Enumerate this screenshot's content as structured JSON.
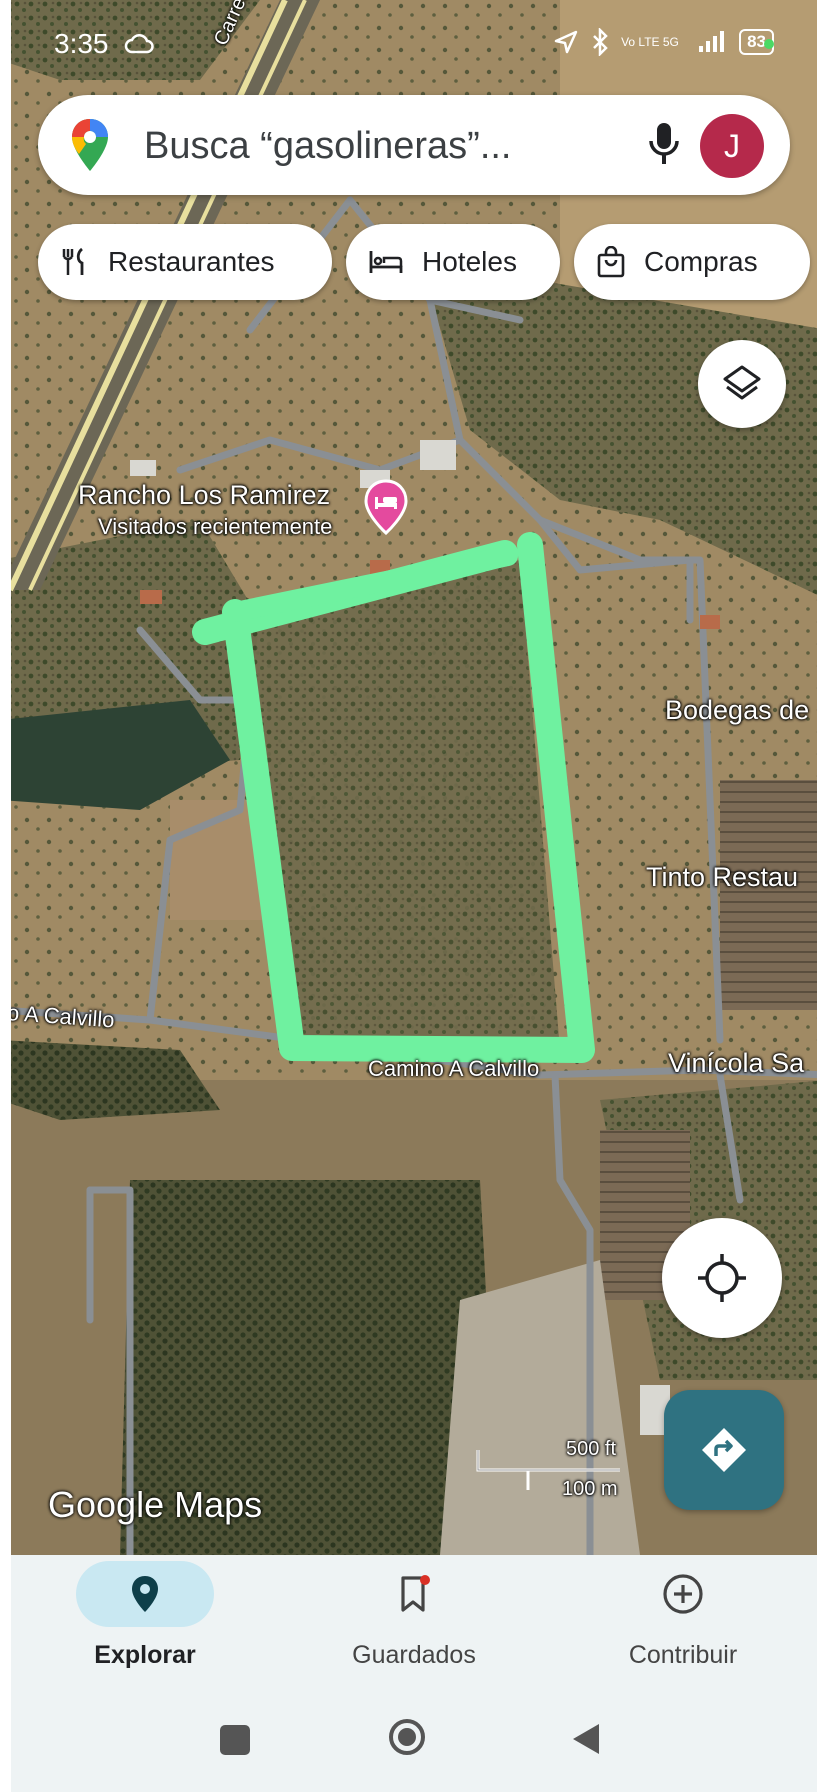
{
  "status_bar": {
    "time": "3:35",
    "network": "Vo LTE 5G",
    "battery": "83"
  },
  "search": {
    "placeholder": "Busca “gasolineras”...",
    "avatar_letter": "J"
  },
  "chips": [
    {
      "label": "Restaurantes",
      "icon": "fork-knife-icon"
    },
    {
      "label": "Hoteles",
      "icon": "bed-icon"
    },
    {
      "label": "Compras",
      "icon": "shopping-bag-icon"
    }
  ],
  "map": {
    "place": {
      "name": "Rancho Los Ramirez",
      "subtitle": "Visitados recientemente",
      "icon": "hotel-pin-icon",
      "pin_color": "#e44a9e"
    },
    "labels": {
      "bodegas": "Bodegas de",
      "tinto": "Tinto Restau",
      "camino_left": "o A Calvillo",
      "camino_center": "Camino A Calvillo",
      "vinicola": "Vinícola Sa",
      "carretera": "Carretera"
    },
    "scale": {
      "imperial": "500 ft",
      "metric": "100 m"
    },
    "watermark": "Google Maps",
    "highlight_color": "#6ff1a0"
  },
  "bottom_nav": {
    "items": [
      {
        "label": "Explorar",
        "icon": "explore-pin-icon",
        "active": true
      },
      {
        "label": "Guardados",
        "icon": "bookmark-icon",
        "active": false
      },
      {
        "label": "Contribuir",
        "icon": "add-circle-icon",
        "active": false
      }
    ],
    "active_color": "#c9e8f2"
  },
  "colors": {
    "accent": "#2f7281",
    "avatar": "#b5294b"
  }
}
